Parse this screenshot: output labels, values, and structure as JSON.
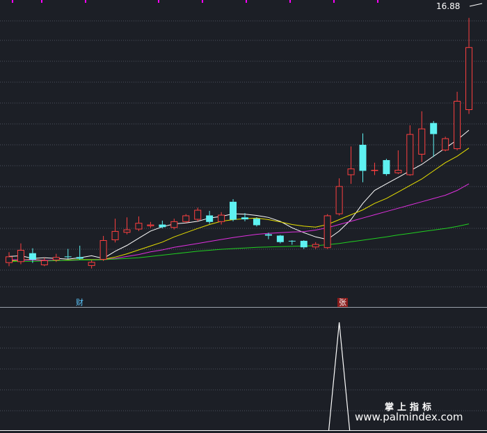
{
  "chart_data": {
    "type": "candlestick",
    "candles": [
      {
        "o": 8.22,
        "h": 8.35,
        "l": 7.92,
        "c": 8.02,
        "dir": "up"
      },
      {
        "o": 8.05,
        "h": 8.62,
        "l": 7.98,
        "c": 8.42,
        "dir": "up"
      },
      {
        "o": 8.32,
        "h": 8.47,
        "l": 8.02,
        "c": 8.12,
        "dir": "down"
      },
      {
        "o": 7.95,
        "h": 8.18,
        "l": 7.92,
        "c": 8.1,
        "dir": "up"
      },
      {
        "o": 8.1,
        "h": 8.3,
        "l": 8.05,
        "c": 8.2,
        "dir": "up"
      },
      {
        "o": 8.22,
        "h": 8.45,
        "l": 8.15,
        "c": 8.2,
        "dir": "down"
      },
      {
        "o": 8.2,
        "h": 8.55,
        "l": 8.12,
        "c": 8.15,
        "dir": "down"
      },
      {
        "o": 7.93,
        "h": 8.1,
        "l": 7.85,
        "c": 8.05,
        "dir": "up"
      },
      {
        "o": 8.12,
        "h": 8.85,
        "l": 8.08,
        "c": 8.72,
        "dir": "up"
      },
      {
        "o": 8.72,
        "h": 9.38,
        "l": 8.65,
        "c": 9.0,
        "dir": "up"
      },
      {
        "o": 8.95,
        "h": 9.42,
        "l": 8.9,
        "c": 9.05,
        "dir": "up"
      },
      {
        "o": 9.05,
        "h": 9.45,
        "l": 9.0,
        "c": 9.25,
        "dir": "up"
      },
      {
        "o": 9.15,
        "h": 9.28,
        "l": 9.1,
        "c": 9.2,
        "dir": "up"
      },
      {
        "o": 9.2,
        "h": 9.32,
        "l": 9.08,
        "c": 9.12,
        "dir": "down"
      },
      {
        "o": 9.1,
        "h": 9.38,
        "l": 9.05,
        "c": 9.3,
        "dir": "up"
      },
      {
        "o": 9.28,
        "h": 9.52,
        "l": 9.25,
        "c": 9.48,
        "dir": "up"
      },
      {
        "o": 9.35,
        "h": 9.72,
        "l": 9.3,
        "c": 9.65,
        "dir": "up"
      },
      {
        "o": 9.48,
        "h": 9.62,
        "l": 9.22,
        "c": 9.28,
        "dir": "down"
      },
      {
        "o": 9.28,
        "h": 9.58,
        "l": 9.2,
        "c": 9.5,
        "dir": "up"
      },
      {
        "o": 9.9,
        "h": 9.98,
        "l": 9.3,
        "c": 9.35,
        "dir": "down"
      },
      {
        "o": 9.42,
        "h": 9.55,
        "l": 9.3,
        "c": 9.36,
        "dir": "down"
      },
      {
        "o": 9.38,
        "h": 9.42,
        "l": 9.14,
        "c": 9.18,
        "dir": "down"
      },
      {
        "o": 8.9,
        "h": 8.95,
        "l": 8.75,
        "c": 8.86,
        "dir": "down"
      },
      {
        "o": 8.86,
        "h": 8.88,
        "l": 8.62,
        "c": 8.66,
        "dir": "down"
      },
      {
        "o": 8.7,
        "h": 8.72,
        "l": 8.58,
        "c": 8.68,
        "dir": "down"
      },
      {
        "o": 8.7,
        "h": 8.72,
        "l": 8.45,
        "c": 8.5,
        "dir": "down"
      },
      {
        "o": 8.5,
        "h": 8.66,
        "l": 8.45,
        "c": 8.6,
        "dir": "up"
      },
      {
        "o": 8.48,
        "h": 9.52,
        "l": 8.45,
        "c": 9.48,
        "dir": "up"
      },
      {
        "o": 9.52,
        "h": 10.62,
        "l": 9.48,
        "c": 10.38,
        "dir": "up"
      },
      {
        "o": 10.72,
        "h": 11.6,
        "l": 10.45,
        "c": 10.92,
        "dir": "up"
      },
      {
        "o": 11.65,
        "h": 12.0,
        "l": 10.5,
        "c": 10.85,
        "dir": "down"
      },
      {
        "o": 10.85,
        "h": 11.1,
        "l": 10.72,
        "c": 10.88,
        "dir": "up"
      },
      {
        "o": 11.18,
        "h": 11.22,
        "l": 10.7,
        "c": 10.75,
        "dir": "down"
      },
      {
        "o": 10.78,
        "h": 11.48,
        "l": 10.75,
        "c": 10.88,
        "dir": "up"
      },
      {
        "o": 10.72,
        "h": 12.25,
        "l": 10.7,
        "c": 11.98,
        "dir": "up"
      },
      {
        "o": 11.35,
        "h": 12.68,
        "l": 11.12,
        "c": 12.15,
        "dir": "up"
      },
      {
        "o": 12.32,
        "h": 12.38,
        "l": 11.28,
        "c": 11.98,
        "dir": "down"
      },
      {
        "o": 11.48,
        "h": 11.9,
        "l": 11.45,
        "c": 11.85,
        "dir": "up"
      },
      {
        "o": 11.52,
        "h": 13.28,
        "l": 11.48,
        "c": 13.0,
        "dir": "up"
      },
      {
        "o": 12.72,
        "h": 15.55,
        "l": 12.6,
        "c": 14.65,
        "dir": "up"
      }
    ],
    "ma_lines": [
      {
        "color": "#ffffff",
        "values": [
          8.22,
          8.24,
          8.16,
          8.18,
          8.16,
          8.14,
          8.18,
          8.24,
          8.16,
          8.38,
          8.56,
          8.78,
          9.0,
          9.13,
          9.22,
          9.25,
          9.3,
          9.4,
          9.45,
          9.53,
          9.52,
          9.48,
          9.42,
          9.3,
          9.1,
          8.95,
          8.82,
          8.74,
          9.0,
          9.35,
          9.85,
          10.25,
          10.45,
          10.65,
          10.85,
          11.05,
          11.3,
          11.55,
          11.8,
          12.1
        ]
      },
      {
        "color": "#e8e000",
        "values": [
          8.08,
          8.11,
          8.13,
          8.1,
          8.09,
          8.11,
          8.12,
          8.12,
          8.13,
          8.2,
          8.3,
          8.42,
          8.54,
          8.66,
          8.82,
          8.95,
          9.08,
          9.2,
          9.3,
          9.35,
          9.38,
          9.4,
          9.35,
          9.28,
          9.2,
          9.15,
          9.12,
          9.2,
          9.35,
          9.5,
          9.65,
          9.85,
          10.0,
          10.2,
          10.4,
          10.6,
          10.85,
          11.1,
          11.3,
          11.55
        ]
      },
      {
        "color": "#e030e0",
        "values": [
          8.12,
          8.11,
          8.11,
          8.1,
          8.1,
          8.1,
          8.11,
          8.11,
          8.12,
          8.16,
          8.22,
          8.28,
          8.36,
          8.42,
          8.5,
          8.56,
          8.62,
          8.68,
          8.74,
          8.8,
          8.85,
          8.9,
          8.93,
          8.95,
          8.97,
          8.98,
          9.03,
          9.1,
          9.2,
          9.3,
          9.4,
          9.5,
          9.6,
          9.7,
          9.8,
          9.9,
          10.0,
          10.1,
          10.25,
          10.45
        ]
      },
      {
        "color": "#20d020",
        "values": [
          8.06,
          8.07,
          8.07,
          8.08,
          8.09,
          8.1,
          8.11,
          8.11,
          8.12,
          8.14,
          8.16,
          8.18,
          8.22,
          8.26,
          8.3,
          8.34,
          8.38,
          8.41,
          8.44,
          8.46,
          8.48,
          8.5,
          8.51,
          8.52,
          8.53,
          8.54,
          8.55,
          8.58,
          8.62,
          8.67,
          8.72,
          8.77,
          8.82,
          8.88,
          8.93,
          8.98,
          9.03,
          9.08,
          9.14,
          9.22
        ]
      }
    ],
    "colors": {
      "up": "#ff4040",
      "down": "#5ef2f2",
      "background": "#1c1f26",
      "grid": "#585e6b",
      "top_markers": "#ff00ff",
      "indicator": "#ffffff"
    },
    "annotations": [
      {
        "text": "财",
        "candle": 6
      },
      {
        "text": "张",
        "candle": 28
      }
    ],
    "max_price_label": "16.88",
    "indicator": {
      "values": [
        0,
        0,
        0,
        0,
        0,
        0,
        0,
        0,
        0,
        0,
        0,
        0,
        0,
        0,
        0,
        0,
        0,
        0,
        0,
        0,
        0,
        0,
        0,
        0,
        0,
        0,
        0,
        0,
        1,
        0,
        0,
        0,
        0,
        0,
        0,
        0,
        0,
        0,
        0,
        0
      ]
    },
    "ylim": [
      7.65,
      16.1
    ],
    "grid": true
  },
  "watermark": {
    "line1": "掌上指标",
    "line2": "www.palmindex.com"
  }
}
